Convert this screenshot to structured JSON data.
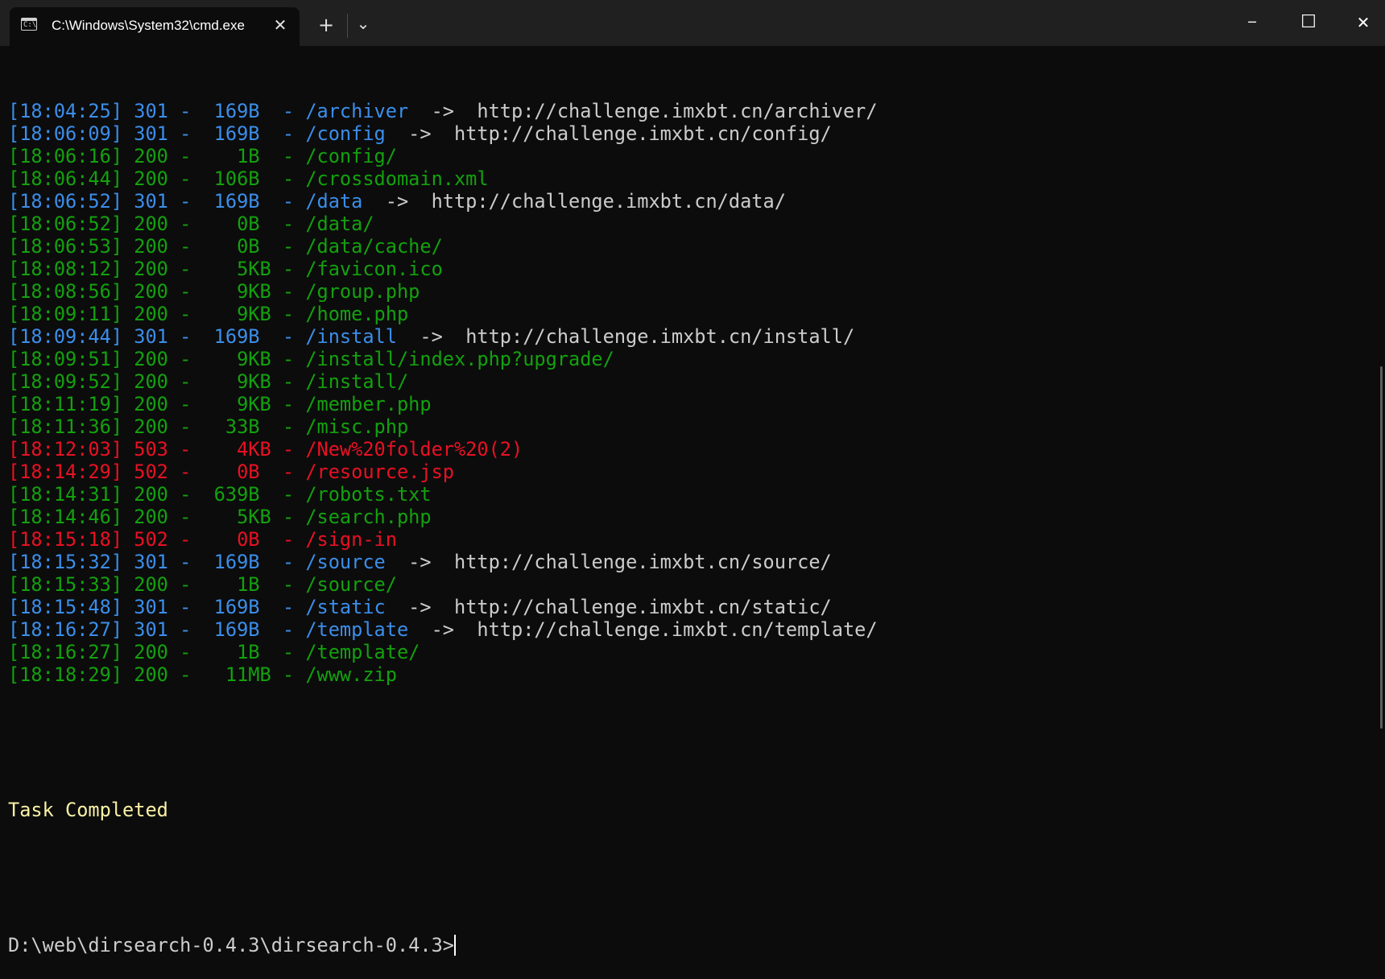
{
  "window": {
    "tab_title": "C:\\Windows\\System32\\cmd.exe",
    "tab_icon_text": "C:\\",
    "tab_close": "✕",
    "new_tab": "+",
    "dropdown": "⌄",
    "minimize": "─",
    "maximize": "☐",
    "close": "✕"
  },
  "colors": {
    "background": "#0c0c0c",
    "titlebar": "#202020",
    "redirect": "#3b8eea",
    "ok": "#13a10e",
    "error": "#e81123",
    "text": "#cccccc",
    "completed": "#f9f1a5"
  },
  "log": [
    {
      "text": "[18:04:25] 301 -  169B  - /archiver",
      "target": "  ->  http://challenge.imxbt.cn/archiver/",
      "status": "blue"
    },
    {
      "text": "[18:06:09] 301 -  169B  - /config",
      "target": "  ->  http://challenge.imxbt.cn/config/",
      "status": "blue"
    },
    {
      "text": "[18:06:16] 200 -    1B  - /config/",
      "target": "",
      "status": "green"
    },
    {
      "text": "[18:06:44] 200 -  106B  - /crossdomain.xml",
      "target": "",
      "status": "green"
    },
    {
      "text": "[18:06:52] 301 -  169B  - /data",
      "target": "  ->  http://challenge.imxbt.cn/data/",
      "status": "blue"
    },
    {
      "text": "[18:06:52] 200 -    0B  - /data/",
      "target": "",
      "status": "green"
    },
    {
      "text": "[18:06:53] 200 -    0B  - /data/cache/",
      "target": "",
      "status": "green"
    },
    {
      "text": "[18:08:12] 200 -    5KB - /favicon.ico",
      "target": "",
      "status": "green"
    },
    {
      "text": "[18:08:56] 200 -    9KB - /group.php",
      "target": "",
      "status": "green"
    },
    {
      "text": "[18:09:11] 200 -    9KB - /home.php",
      "target": "",
      "status": "green"
    },
    {
      "text": "[18:09:44] 301 -  169B  - /install",
      "target": "  ->  http://challenge.imxbt.cn/install/",
      "status": "blue"
    },
    {
      "text": "[18:09:51] 200 -    9KB - /install/index.php?upgrade/",
      "target": "",
      "status": "green"
    },
    {
      "text": "[18:09:52] 200 -    9KB - /install/",
      "target": "",
      "status": "green"
    },
    {
      "text": "[18:11:19] 200 -    9KB - /member.php",
      "target": "",
      "status": "green"
    },
    {
      "text": "[18:11:36] 200 -   33B  - /misc.php",
      "target": "",
      "status": "green"
    },
    {
      "text": "[18:12:03] 503 -    4KB - /New%20folder%20(2)",
      "target": "",
      "status": "red"
    },
    {
      "text": "[18:14:29] 502 -    0B  - /resource.jsp",
      "target": "",
      "status": "red"
    },
    {
      "text": "[18:14:31] 200 -  639B  - /robots.txt",
      "target": "",
      "status": "green"
    },
    {
      "text": "[18:14:46] 200 -    5KB - /search.php",
      "target": "",
      "status": "green"
    },
    {
      "text": "[18:15:18] 502 -    0B  - /sign-in",
      "target": "",
      "status": "red"
    },
    {
      "text": "[18:15:32] 301 -  169B  - /source",
      "target": "  ->  http://challenge.imxbt.cn/source/",
      "status": "blue"
    },
    {
      "text": "[18:15:33] 200 -    1B  - /source/",
      "target": "",
      "status": "green"
    },
    {
      "text": "[18:15:48] 301 -  169B  - /static",
      "target": "  ->  http://challenge.imxbt.cn/static/",
      "status": "blue"
    },
    {
      "text": "[18:16:27] 301 -  169B  - /template",
      "target": "  ->  http://challenge.imxbt.cn/template/",
      "status": "blue"
    },
    {
      "text": "[18:16:27] 200 -    1B  - /template/",
      "target": "",
      "status": "green"
    },
    {
      "text": "[18:18:29] 200 -   11MB - /www.zip",
      "target": "",
      "status": "green"
    }
  ],
  "task_completed": "Task Completed",
  "prompt": "D:\\web\\dirsearch-0.4.3\\dirsearch-0.4.3>"
}
